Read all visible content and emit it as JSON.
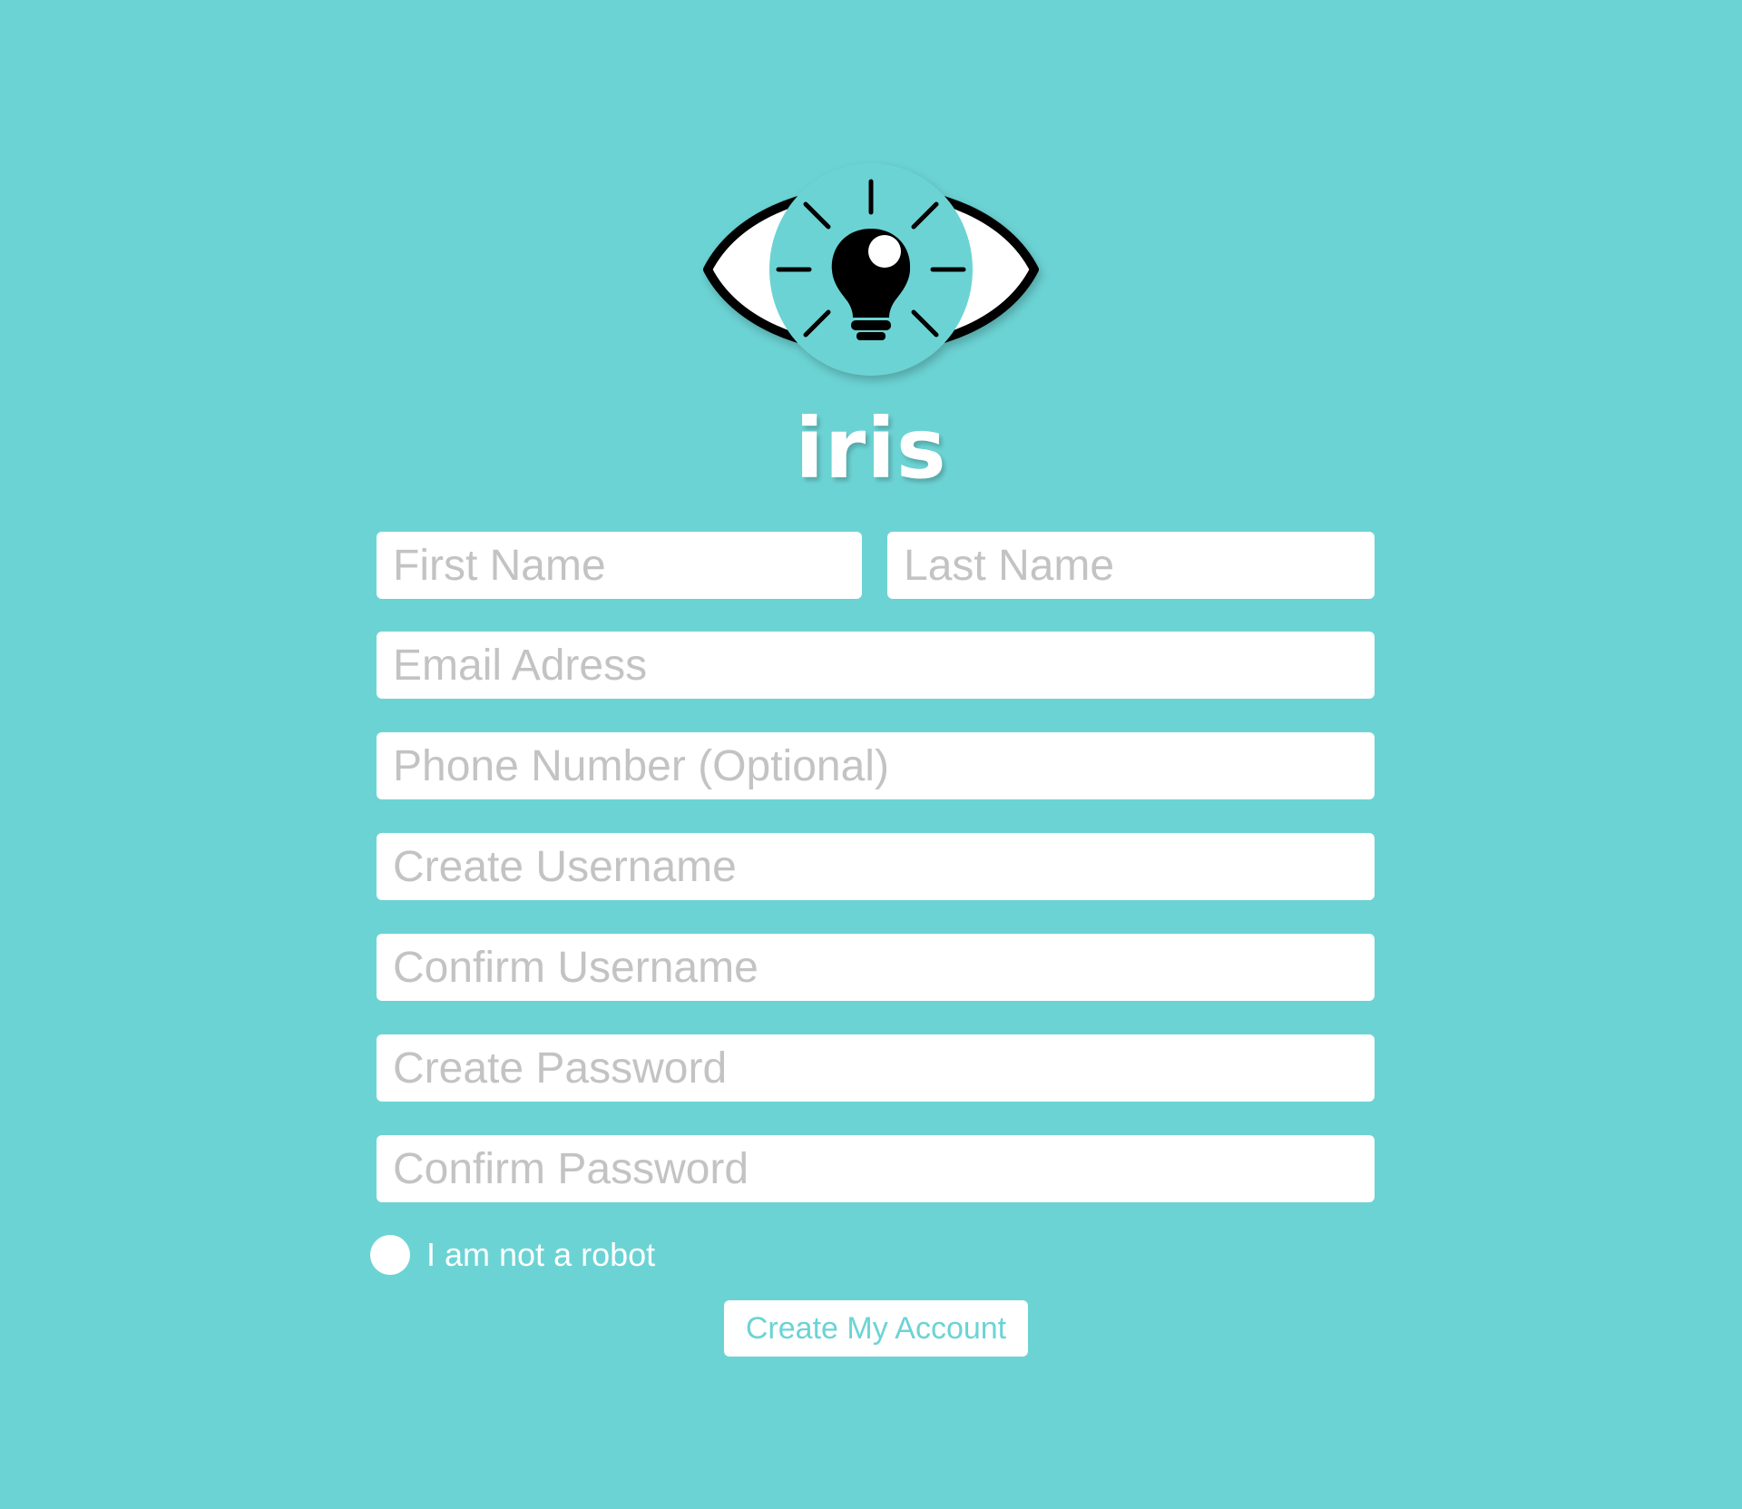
{
  "brand": {
    "name": "iris",
    "logo_icon": "eye-lightbulb-icon"
  },
  "form": {
    "first_name": {
      "placeholder": "First Name",
      "value": ""
    },
    "last_name": {
      "placeholder": "Last Name",
      "value": ""
    },
    "email": {
      "placeholder": "Email Adress",
      "value": ""
    },
    "phone": {
      "placeholder": "Phone Number (Optional)",
      "value": ""
    },
    "create_username": {
      "placeholder": "Create Username",
      "value": ""
    },
    "confirm_username": {
      "placeholder": "Confirm Username",
      "value": ""
    },
    "create_password": {
      "placeholder": "Create Password",
      "value": ""
    },
    "confirm_password": {
      "placeholder": "Confirm Password",
      "value": ""
    },
    "robot_check": {
      "label": "I am not a robot",
      "checked": false
    },
    "submit_label": "Create My Account"
  },
  "colors": {
    "background": "#6cd3d4",
    "field_background": "#ffffff",
    "placeholder": "#c3c3c3",
    "accent": "#6cd3d4",
    "logo_outline": "#000000"
  }
}
